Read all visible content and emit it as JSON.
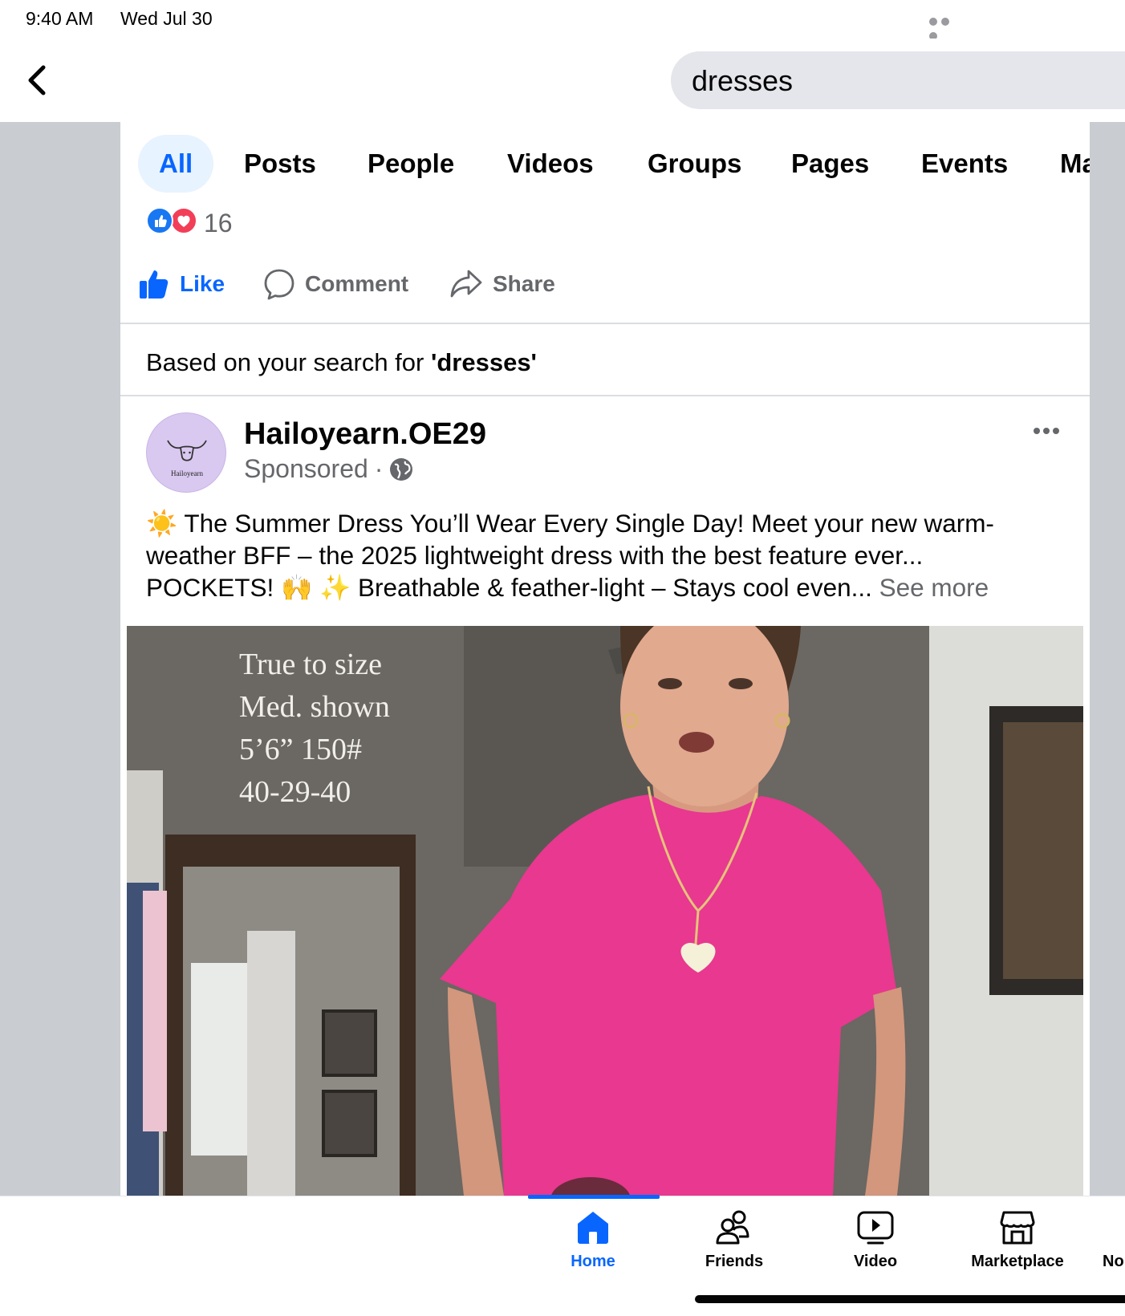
{
  "status_bar": {
    "time": "9:40 AM",
    "date": "Wed Jul 30"
  },
  "search": {
    "query": "dresses"
  },
  "tabs": [
    {
      "label": "All",
      "active": true
    },
    {
      "label": "Posts"
    },
    {
      "label": "People"
    },
    {
      "label": "Videos"
    },
    {
      "label": "Groups"
    },
    {
      "label": "Pages"
    },
    {
      "label": "Events"
    },
    {
      "label": "Ma"
    }
  ],
  "reactions": {
    "count": "16",
    "types": [
      "like",
      "love"
    ]
  },
  "actions": {
    "like": "Like",
    "comment": "Comment",
    "share": "Share"
  },
  "recommendation": {
    "prefix": "Based on your search for ",
    "term": "'dresses'"
  },
  "post": {
    "page_name": "Hailoyearn.OE29",
    "avatar_text": "Hailoyearn",
    "sponsored": "Sponsored",
    "separator": "·",
    "text_lines": [
      "☀️ The Summer Dress You’ll Wear Every Single Day! Meet your new warm-",
      "weather BFF – the 2025 lightweight dress with the best feature ever...",
      "POCKETS! 🙌 ✨ Breathable & feather-light – Stays cool even..."
    ],
    "see_more": "See more",
    "media_overlay_lines": [
      "True to size",
      "Med. shown",
      "5’6” 150#",
      "40-29-40"
    ]
  },
  "bottom_nav": [
    {
      "label": "Home",
      "icon": "home-icon",
      "active": true
    },
    {
      "label": "Friends",
      "icon": "friends-icon"
    },
    {
      "label": "Video",
      "icon": "video-icon"
    },
    {
      "label": "Marketplace",
      "icon": "marketplace-icon"
    },
    {
      "label": "No",
      "icon": "notifications-icon"
    }
  ],
  "colors": {
    "accent": "#0866ff",
    "love": "#f33e58",
    "secondary_text": "#65676b",
    "shirt": "#e8388f"
  }
}
